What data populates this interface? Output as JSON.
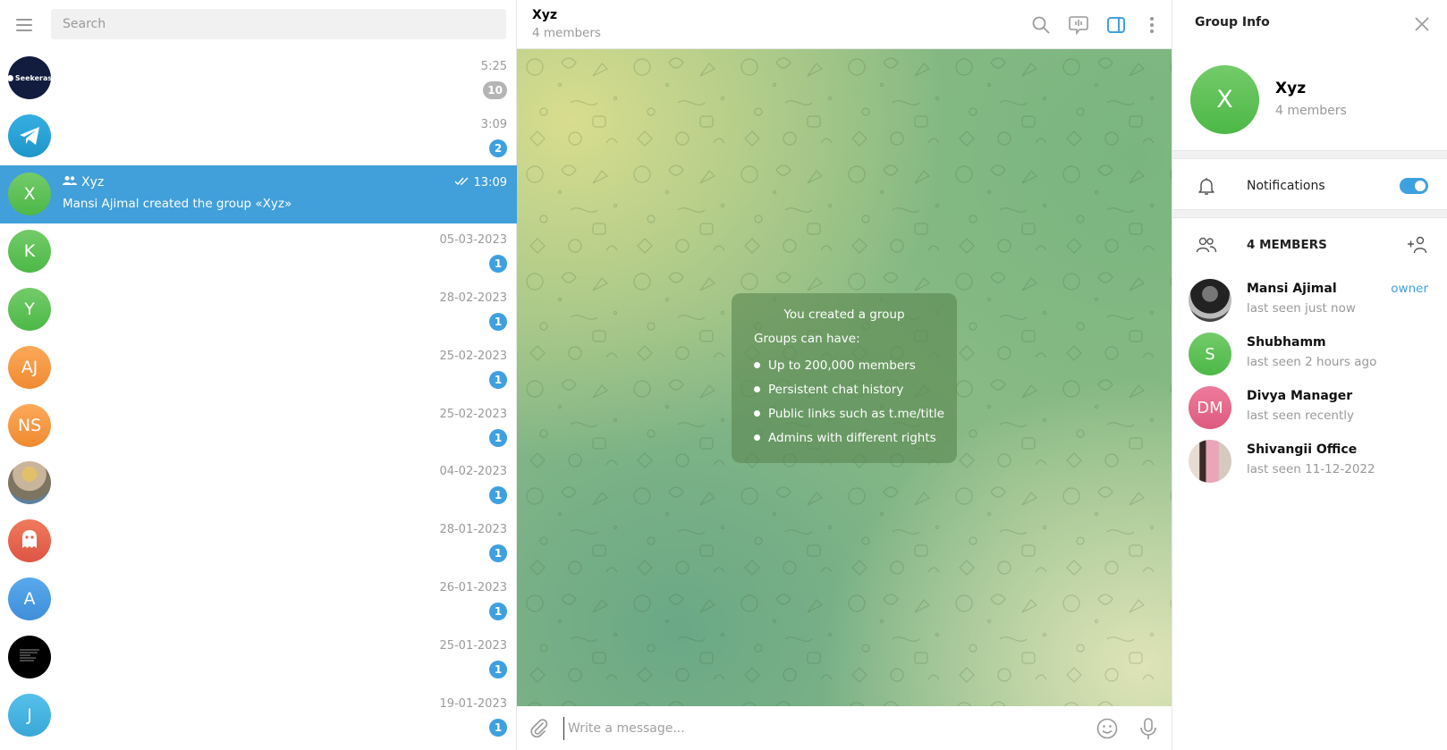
{
  "sidebar": {
    "search_placeholder": "Search",
    "chats": [
      {
        "name": "",
        "initials": "",
        "avatar": "seekeras-logo",
        "avatar_label": "Seekeras",
        "avatar_color": "#121c3f",
        "time": "5:25",
        "unread": "10",
        "muted": true
      },
      {
        "name": "",
        "initials": "",
        "avatar": "telegram-logo",
        "avatar_color": "#2aa2dd",
        "time": "3:09",
        "unread": "2",
        "muted": false
      },
      {
        "name": "Xyz",
        "initials": "X",
        "avatar_color": "#5cbf55",
        "time": "13:09",
        "last_message": "Mansi Ajimal created the group «Xyz»",
        "is_group": true,
        "read": true,
        "selected": true
      },
      {
        "name": "",
        "initials": "K",
        "avatar_color": "#5cbf55",
        "time": "05-03-2023",
        "unread": "1"
      },
      {
        "name": "",
        "initials": "Y",
        "avatar_color": "#5cbf55",
        "time": "28-02-2023",
        "unread": "1"
      },
      {
        "name": "",
        "initials": "AJ",
        "avatar_color": "#f5953e",
        "time": "25-02-2023",
        "unread": "1"
      },
      {
        "name": "",
        "initials": "NS",
        "avatar_color": "#f5953e",
        "time": "25-02-2023",
        "unread": "1"
      },
      {
        "name": "",
        "initials": "",
        "avatar": "photo",
        "avatar_color": "#8d8a77",
        "time": "04-02-2023",
        "unread": "1"
      },
      {
        "name": "",
        "initials": "",
        "avatar": "ghost-icon",
        "avatar_color": "#e5604d",
        "time": "28-01-2023",
        "unread": "1"
      },
      {
        "name": "",
        "initials": "A",
        "avatar_color": "#4a9be2",
        "time": "26-01-2023",
        "unread": "1"
      },
      {
        "name": "",
        "initials": "",
        "avatar": "text-image",
        "avatar_color": "#000000",
        "time": "25-01-2023",
        "unread": "1"
      },
      {
        "name": "",
        "initials": "J",
        "avatar_color": "#45b3e0",
        "time": "19-01-2023",
        "unread": "1"
      }
    ]
  },
  "chat": {
    "title": "Xyz",
    "subtitle": "4 members",
    "service_message": {
      "title": "You created a group",
      "subtitle": "Groups can have:",
      "items": [
        "Up to 200,000 members",
        "Persistent chat history",
        "Public links such as t.me/title",
        "Admins with different rights"
      ]
    },
    "input_placeholder": "Write a message..."
  },
  "info_panel": {
    "title": "Group Info",
    "group_name": "Xyz",
    "group_initial": "X",
    "group_subtitle": "4 members",
    "notifications_label": "Notifications",
    "notifications_on": true,
    "members_header": "4 MEMBERS",
    "members": [
      {
        "name": "Mansi Ajimal",
        "status": "last seen just now",
        "role": "owner",
        "initials": "",
        "avatar": "photo",
        "avatar_color": "#333333"
      },
      {
        "name": "Shubhamm",
        "status": "last seen 2 hours ago",
        "role": "",
        "initials": "S",
        "avatar_color": "#5cbf55"
      },
      {
        "name": "Divya Manager",
        "status": "last seen recently",
        "role": "",
        "initials": "DM",
        "avatar_color": "#e5688a"
      },
      {
        "name": "Shivangii Office",
        "status": "last seen 11-12-2022",
        "role": "",
        "initials": "",
        "avatar": "photo",
        "avatar_color": "#c9a4a8"
      }
    ]
  },
  "colors": {
    "accent": "#419fd9",
    "badge": "#3fa0e0",
    "badge_muted": "#b4b4b4"
  }
}
